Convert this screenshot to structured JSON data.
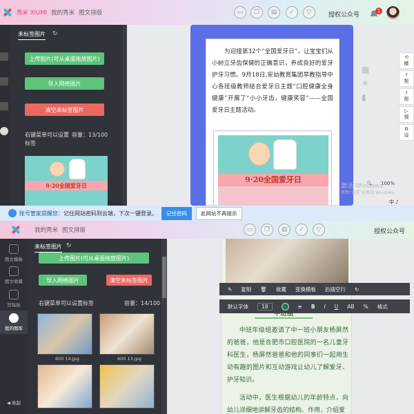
{
  "shot1": {
    "nav": {
      "brand": "秀米 XIUMI",
      "my_xiumi": "我的秀米",
      "layout": "图文排版"
    },
    "auth_label": "授权公众号",
    "notification_count": "1",
    "panel": {
      "tab_active": "未标签图片",
      "upload_btn": "上传图片(可从桌面拖放图片)",
      "import_btn": "导入网络图片",
      "clear_btn": "清空未标签图片",
      "hint": "右键菜单可以设置标签",
      "capacity": "容量：13/100"
    },
    "article_text": "为迎接第32个“全国爱牙日”，让宝宝们从小树立牙齿保健的正确意识，养成良好的爱牙护牙习惯。9月18日,安幼教育集团早教指导中心各班级教师结合爱牙日主题“口腔健康全身健康”开展了“小小牙齿，健康笑容”——全国爱牙日主题活动。",
    "banner_title": "9·20全国爱牙日",
    "side_panel": [
      "撤",
      "帮",
      "帮",
      "预",
      "设"
    ],
    "zoom_label": "100%",
    "watermark": "激活 Windows",
    "watermark_sub": "转到“设置”以激活 Windows。",
    "ime": "中 ♪"
  },
  "shot2": {
    "notify": {
      "title": "账号管家提醒您：",
      "message": "记住网站密码到云端，下次一键登录。",
      "remember_btn": "记住密码",
      "never_btn": "此网站不再提示"
    },
    "nav": {
      "my_xiumi": "我的秀米",
      "layout": "图文排版"
    },
    "auth_label": "授权公众号",
    "sidebar": [
      {
        "label": "图文模板"
      },
      {
        "label": "图文收藏"
      },
      {
        "label": "剪贴板"
      },
      {
        "label": "我的图库"
      }
    ],
    "collapse": "收起",
    "panel": {
      "tab_active": "未标签图片",
      "upload_btn": "上传图片(可从桌面拖放图片)",
      "import_btn": "导入网络图片",
      "clear_btn": "清空未标签图片",
      "hint": "右键菜单可以设置标签",
      "capacity": "容量：14/100"
    },
    "thumbs": [
      {
        "caption": "600 14.jpg"
      },
      {
        "caption": "600 13.jpg"
      }
    ],
    "toolbar_row1": [
      "复制",
      "收藏",
      "变换模板",
      "后插空行"
    ],
    "toolbar_row2": {
      "font": "默认字体",
      "size": "18",
      "style_label": "格式"
    },
    "toolbar_format_glyphs": [
      "≡",
      "B",
      "I",
      "U",
      "AB",
      "%"
    ],
    "section_title": "中班组",
    "article_para1": "中班年级组邀请了中一班小朋友杨屏然的爸爸，他是合肥市口腔医院的一名儿童牙科医生，杨屏然爸爸和他的同事们一起用生动有趣的图片和互动游戏让幼儿了解爱牙、护牙知识。",
    "article_para2": "活动中，医生根据幼儿的年龄特点，向幼儿详细地讲解牙齿的结构、作用，介绍爱"
  },
  "colors": {
    "accent_pink": "#e8457a",
    "green_btn": "#5ec37b",
    "red_btn": "#ec6760",
    "dark_panel": "#303339",
    "phone_blue": "#5a6fe6"
  }
}
